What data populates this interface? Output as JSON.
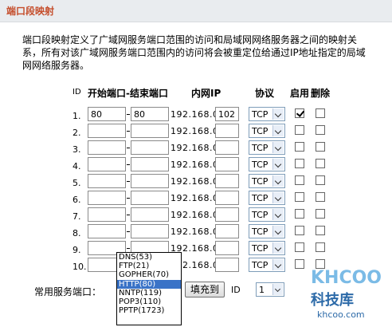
{
  "header": {
    "title": "端口段映射"
  },
  "description": "端口段映射定义了广域网服务端口范围的访问和局域网网络服务器之间的映射关系，所有对该广域网服务端口范围内的访问将会被重定位给通过IP地址指定的局域网网络服务器。",
  "columns": {
    "id": "ID",
    "port_range": "开始端口-结束端口",
    "lan_ip": "内网IP",
    "protocol": "协议",
    "enable": "启用",
    "delete": "删除"
  },
  "ip_prefix": "192.168.0.",
  "rows": [
    {
      "id": "1.",
      "start": "80",
      "end": "80",
      "ip_last": "102",
      "protocol": "TCP",
      "enabled": true,
      "delete": false
    },
    {
      "id": "2.",
      "start": "",
      "end": "",
      "ip_last": "",
      "protocol": "TCP",
      "enabled": false,
      "delete": false
    },
    {
      "id": "3.",
      "start": "",
      "end": "",
      "ip_last": "",
      "protocol": "TCP",
      "enabled": false,
      "delete": false
    },
    {
      "id": "4.",
      "start": "",
      "end": "",
      "ip_last": "",
      "protocol": "TCP",
      "enabled": false,
      "delete": false
    },
    {
      "id": "5.",
      "start": "",
      "end": "",
      "ip_last": "",
      "protocol": "TCP",
      "enabled": false,
      "delete": false
    },
    {
      "id": "6.",
      "start": "",
      "end": "",
      "ip_last": "",
      "protocol": "TCP",
      "enabled": false,
      "delete": false
    },
    {
      "id": "7.",
      "start": "",
      "end": "",
      "ip_last": "",
      "protocol": "TCP",
      "enabled": false,
      "delete": false
    },
    {
      "id": "8.",
      "start": "",
      "end": "",
      "ip_last": "",
      "protocol": "TCP",
      "enabled": false,
      "delete": false
    },
    {
      "id": "9.",
      "start": "",
      "end": "",
      "ip_last": "",
      "protocol": "TCP",
      "enabled": false,
      "delete": false
    },
    {
      "id": "10.",
      "start": "",
      "end": "",
      "ip_last": "",
      "protocol": "TCP",
      "enabled": false,
      "delete": false
    }
  ],
  "common_services": {
    "label": "常用服务端口：",
    "options": [
      "DNS(53)",
      "FTP(21)",
      "GOPHER(70)",
      "HTTP(80)",
      "NNTP(119)",
      "POP3(110)",
      "PPTP(1723)"
    ],
    "selected": "HTTP(80)",
    "fill_button": "填充到",
    "id_label": "ID",
    "id_value": "1"
  },
  "watermark": {
    "logo": "KHCOO",
    "name": "科技库",
    "url": "khcoo.com"
  },
  "colors": {
    "title": "#c54e2c",
    "selection": "#3a73c7",
    "watermark": "#2c6aa8"
  }
}
